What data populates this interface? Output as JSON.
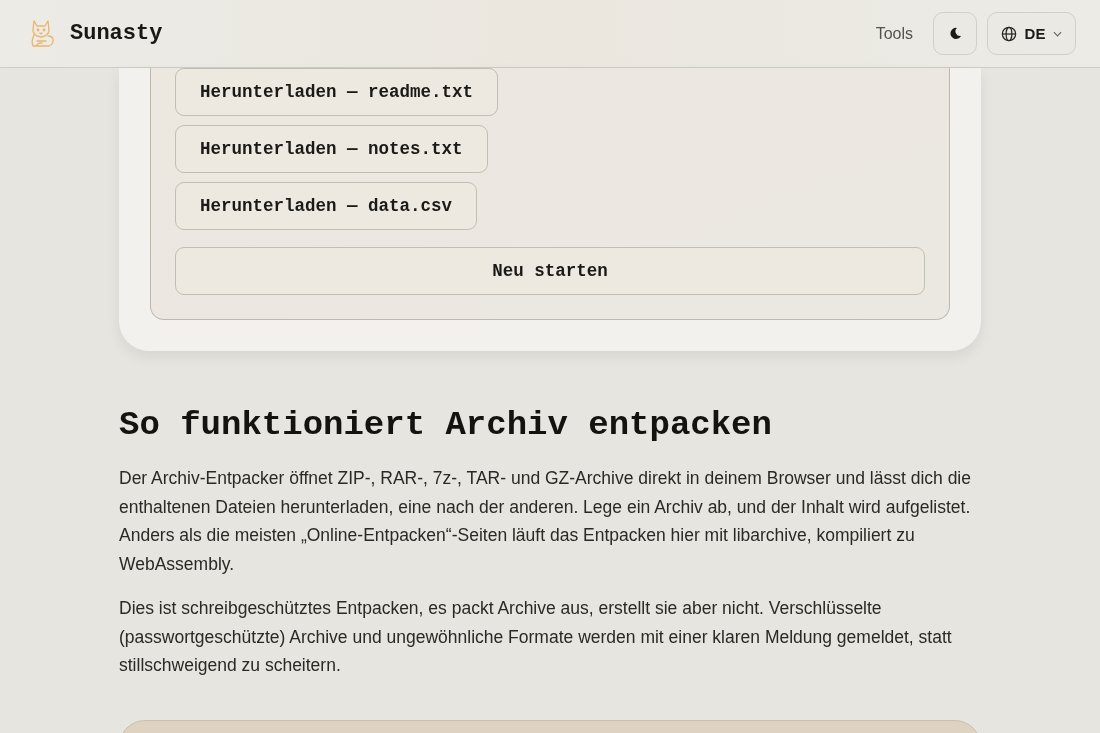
{
  "header": {
    "brand": "Sunasty",
    "nav": [
      {
        "label": "Tools"
      }
    ],
    "language": {
      "code": "DE"
    }
  },
  "downloads": [
    {
      "label": "Herunterladen — readme.txt"
    },
    {
      "label": "Herunterladen — notes.txt"
    },
    {
      "label": "Herunterladen — data.csv"
    }
  ],
  "restart_button": "Neu starten",
  "article": {
    "heading": "So funktioniert Archiv entpacken",
    "paragraphs": [
      "Der Archiv-Entpacker öffnet ZIP-, RAR-, 7z-, TAR- und GZ-Archive direkt in deinem Browser und lässt dich die enthaltenen Dateien herunterladen, eine nach der anderen. Lege ein Archiv ab, und der Inhalt wird aufgelistet. Anders als die meisten „Online-Entpacken“-Seiten läuft das Entpacken hier mit libarchive, kompiliert zu WebAssembly.",
      "Dies ist schreibgeschütztes Entpacken, es packt Archive aus, erstellt sie aber nicht. Verschlüsselte (passwortgeschützte) Archive und ungewöhnliche Formate werden mit einer klaren Meldung gemeldet, statt stillschweigend zu scheitern."
    ]
  }
}
